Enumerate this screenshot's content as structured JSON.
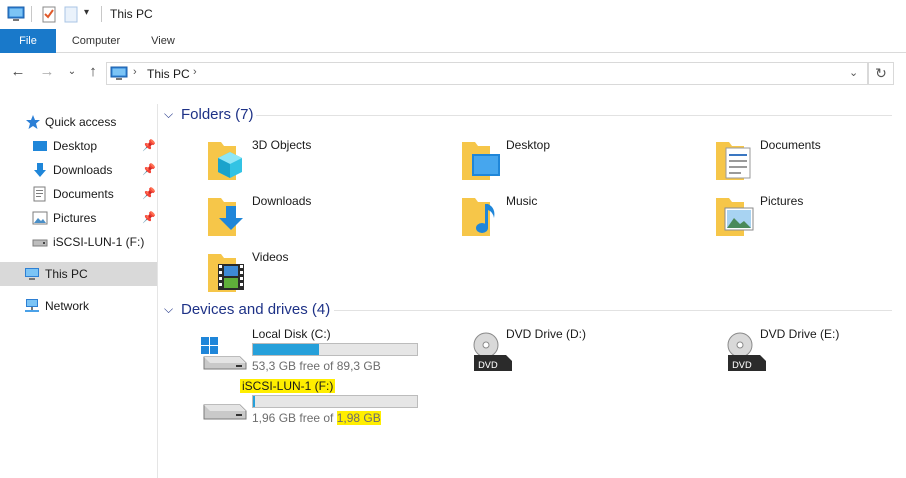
{
  "window": {
    "title": "This PC"
  },
  "ribbon": {
    "tabs": [
      "File",
      "Computer",
      "View"
    ]
  },
  "addressbar": {
    "breadcrumb": "This PC"
  },
  "sidebar": {
    "items": [
      {
        "label": "Quick access",
        "icon": "star-icon"
      },
      {
        "label": "Desktop",
        "icon": "desktop-folder-icon",
        "pinned": true
      },
      {
        "label": "Downloads",
        "icon": "download-arrow-icon",
        "pinned": true
      },
      {
        "label": "Documents",
        "icon": "document-icon",
        "pinned": true
      },
      {
        "label": "Pictures",
        "icon": "picture-icon",
        "pinned": true
      },
      {
        "label": "iSCSI-LUN-1 (F:)",
        "icon": "drive-icon"
      },
      {
        "label": "This PC",
        "icon": "computer-icon",
        "selected": true
      },
      {
        "label": "Network",
        "icon": "network-icon"
      }
    ]
  },
  "folders": {
    "header": "Folders (7)",
    "items": [
      "3D Objects",
      "Desktop",
      "Documents",
      "Downloads",
      "Music",
      "Pictures",
      "Videos"
    ]
  },
  "devices": {
    "header": "Devices and drives (4)",
    "drives": [
      {
        "name": "Local Disk (C:)",
        "free_prefix": "53,3 GB free of ",
        "total": "89,3 GB",
        "used_fraction": 0.403,
        "highlight": false
      },
      {
        "name": "DVD Drive (D:)",
        "type": "dvd"
      },
      {
        "name": "DVD Drive (E:)",
        "type": "dvd"
      },
      {
        "name": "iSCSI-LUN-1 (F:)",
        "free_prefix": "1,96 GB free of ",
        "total": "1,98 GB",
        "used_fraction": 0.01,
        "highlight": true
      }
    ]
  },
  "colors": {
    "accent": "#1979ca",
    "group_header": "#1e3287",
    "drive_bar": "#26a0da",
    "highlight": "#ffee00"
  }
}
